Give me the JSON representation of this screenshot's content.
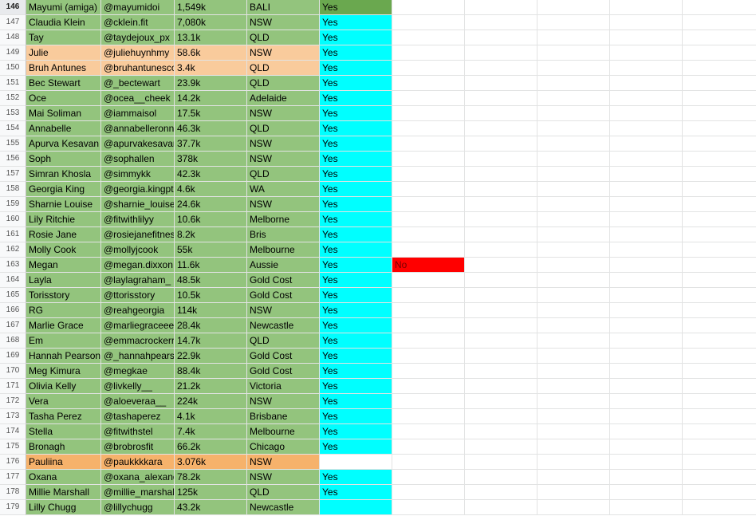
{
  "colors": {
    "green": "#93c47d",
    "green_selected_status": "#6aa84f",
    "peach": "#f9cb9c",
    "orange": "#f6b26b",
    "cyan": "#00ffff",
    "red": "#ff0000",
    "white": "#ffffff"
  },
  "rows": [
    {
      "num": "146",
      "name": "Mayumi (amiga)",
      "handle": "@mayumidoi",
      "followers": "1,549k",
      "location": "BALI",
      "status": "Yes",
      "extra": "",
      "row_color": "green",
      "status_color": "green_selected_status",
      "selected": true
    },
    {
      "num": "147",
      "name": "Claudia Klein",
      "handle": "@cklein.fit",
      "followers": "7,080k",
      "location": "NSW",
      "status": "Yes",
      "extra": "",
      "row_color": "green",
      "status_color": "cyan"
    },
    {
      "num": "148",
      "name": "Tay",
      "handle": "@taydejoux_px",
      "followers": "13.1k",
      "location": "QLD",
      "status": "Yes",
      "extra": "",
      "row_color": "green",
      "status_color": "cyan"
    },
    {
      "num": "149",
      "name": "Julie",
      "handle": "@juliehuynhmy",
      "followers": "58.6k",
      "location": "NSW",
      "status": "Yes",
      "extra": "",
      "row_color": "peach",
      "status_color": "cyan"
    },
    {
      "num": "150",
      "name": "Bruh Antunes",
      "handle": "@bruhantunesco",
      "followers": "3.4k",
      "location": "QLD",
      "status": "Yes",
      "extra": "",
      "row_color": "peach",
      "status_color": "cyan"
    },
    {
      "num": "151",
      "name": "Bec Stewart",
      "handle": "@_bectewart",
      "followers": "23.9k",
      "location": "QLD",
      "status": "Yes",
      "extra": "",
      "row_color": "green",
      "status_color": "cyan"
    },
    {
      "num": "152",
      "name": "Oce",
      "handle": "@ocea__cheek",
      "followers": "14.2k",
      "location": "Adelaide",
      "status": "Yes",
      "extra": "",
      "row_color": "green",
      "status_color": "cyan"
    },
    {
      "num": "153",
      "name": "Mai Soliman",
      "handle": "@iammaisol",
      "followers": "17.5k",
      "location": "NSW",
      "status": "Yes",
      "extra": "",
      "row_color": "green",
      "status_color": "cyan"
    },
    {
      "num": "154",
      "name": "Annabelle",
      "handle": "@annabelleronn",
      "followers": "46.3k",
      "location": "QLD",
      "status": "Yes",
      "extra": "",
      "row_color": "green",
      "status_color": "cyan"
    },
    {
      "num": "155",
      "name": "Apurva Kesavan",
      "handle": "@apurvakesavan",
      "followers": "37.7k",
      "location": "NSW",
      "status": "Yes",
      "extra": "",
      "row_color": "green",
      "status_color": "cyan"
    },
    {
      "num": "156",
      "name": "Soph",
      "handle": "@sophallen",
      "followers": "378k",
      "location": "NSW",
      "status": "Yes",
      "extra": "",
      "row_color": "green",
      "status_color": "cyan"
    },
    {
      "num": "157",
      "name": "Simran Khosla",
      "handle": "@simmykk",
      "followers": "42.3k",
      "location": "QLD",
      "status": "Yes",
      "extra": "",
      "row_color": "green",
      "status_color": "cyan"
    },
    {
      "num": "158",
      "name": "Georgia King",
      "handle": "@georgia.kingpt",
      "followers": "4.6k",
      "location": "WA",
      "status": "Yes",
      "extra": "",
      "row_color": "green",
      "status_color": "cyan"
    },
    {
      "num": "159",
      "name": "Sharnie Louise",
      "handle": "@sharnie_louise",
      "followers": "24.6k",
      "location": "NSW",
      "status": "Yes",
      "extra": "",
      "row_color": "green",
      "status_color": "cyan"
    },
    {
      "num": "160",
      "name": "Lily Ritchie",
      "handle": "@fitwithlilyy",
      "followers": "10.6k",
      "location": "Melborne",
      "status": "Yes",
      "extra": "",
      "row_color": "green",
      "status_color": "cyan"
    },
    {
      "num": "161",
      "name": "Rosie Jane",
      "handle": "@rosiejanefitness",
      "followers": "8.2k",
      "location": "Bris",
      "status": "Yes",
      "extra": "",
      "row_color": "green",
      "status_color": "cyan"
    },
    {
      "num": "162",
      "name": "Molly Cook",
      "handle": "@mollyjcook",
      "followers": "55k",
      "location": "Melbourne",
      "status": "Yes",
      "extra": "",
      "row_color": "green",
      "status_color": "cyan"
    },
    {
      "num": "163",
      "name": "Megan",
      "handle": "@megan.dixxon",
      "followers": "11.6k",
      "location": "Aussie",
      "status": "Yes",
      "extra": "No",
      "row_color": "green",
      "status_color": "cyan",
      "extra_color": "red"
    },
    {
      "num": "164",
      "name": "Layla",
      "handle": "@laylagraham_",
      "followers": "48.5k",
      "location": "Gold Cost",
      "status": "Yes",
      "extra": "",
      "row_color": "green",
      "status_color": "cyan"
    },
    {
      "num": "165",
      "name": "Torisstory",
      "handle": "@ttorisstory",
      "followers": "10.5k",
      "location": "Gold Cost",
      "status": "Yes",
      "extra": "",
      "row_color": "green",
      "status_color": "cyan"
    },
    {
      "num": "166",
      "name": "RG",
      "handle": "@reahgeorgia",
      "followers": "114k",
      "location": "NSW",
      "status": "Yes",
      "extra": "",
      "row_color": "green",
      "status_color": "cyan"
    },
    {
      "num": "167",
      "name": "Marlie Grace",
      "handle": "@marliegraceee",
      "followers": "28.4k",
      "location": "Newcastle",
      "status": "Yes",
      "extra": "",
      "row_color": "green",
      "status_color": "cyan"
    },
    {
      "num": "168",
      "name": "Em",
      "handle": "@emmacrockerr",
      "followers": "14.7k",
      "location": "QLD",
      "status": "Yes",
      "extra": "",
      "row_color": "green",
      "status_color": "cyan"
    },
    {
      "num": "169",
      "name": "Hannah Pearson",
      "handle": "@_hannahpearson",
      "followers": "22.9k",
      "location": "Gold Cost",
      "status": "Yes",
      "extra": "",
      "row_color": "green",
      "status_color": "cyan"
    },
    {
      "num": "170",
      "name": "Meg Kimura",
      "handle": "@megkae",
      "followers": "88.4k",
      "location": "Gold Cost",
      "status": "Yes",
      "extra": "",
      "row_color": "green",
      "status_color": "cyan"
    },
    {
      "num": "171",
      "name": "Olivia Kelly",
      "handle": "@livkelly__",
      "followers": "21.2k",
      "location": "Victoria",
      "status": "Yes",
      "extra": "",
      "row_color": "green",
      "status_color": "cyan"
    },
    {
      "num": "172",
      "name": "Vera",
      "handle": "@aloeveraa__",
      "followers": "224k",
      "location": "NSW",
      "status": "Yes",
      "extra": "",
      "row_color": "green",
      "status_color": "cyan"
    },
    {
      "num": "173",
      "name": "Tasha Perez",
      "handle": "@tashaperez",
      "followers": "4.1k",
      "location": "Brisbane",
      "status": "Yes",
      "extra": "",
      "row_color": "green",
      "status_color": "cyan"
    },
    {
      "num": "174",
      "name": "Stella",
      "handle": "@fitwithstel",
      "followers": "7.4k",
      "location": "Melbourne",
      "status": "Yes",
      "extra": "",
      "row_color": "green",
      "status_color": "cyan"
    },
    {
      "num": "175",
      "name": "Bronagh",
      "handle": "@brobrosfit",
      "followers": "66.2k",
      "location": "Chicago",
      "status": "Yes",
      "extra": "",
      "row_color": "green",
      "status_color": "cyan"
    },
    {
      "num": "176",
      "name": "Pauliina",
      "handle": "@paukkkkara",
      "followers": "3.076k",
      "location": "NSW",
      "status": "",
      "extra": "",
      "row_color": "orange",
      "status_color": "white"
    },
    {
      "num": "177",
      "name": "Oxana",
      "handle": "@oxana_alexandra",
      "followers": "78.2k",
      "location": "NSW",
      "status": "Yes",
      "extra": "",
      "row_color": "green",
      "status_color": "cyan"
    },
    {
      "num": "178",
      "name": "Millie Marshall",
      "handle": "@millie_marshall",
      "followers": "125k",
      "location": "QLD",
      "status": "Yes",
      "extra": "",
      "row_color": "green",
      "status_color": "cyan"
    },
    {
      "num": "179",
      "name": "Lilly Chugg",
      "handle": "@lillychugg",
      "followers": "43.2k",
      "location": "Newcastle",
      "status": "",
      "extra": "",
      "row_color": "green",
      "status_color": "cyan"
    }
  ]
}
